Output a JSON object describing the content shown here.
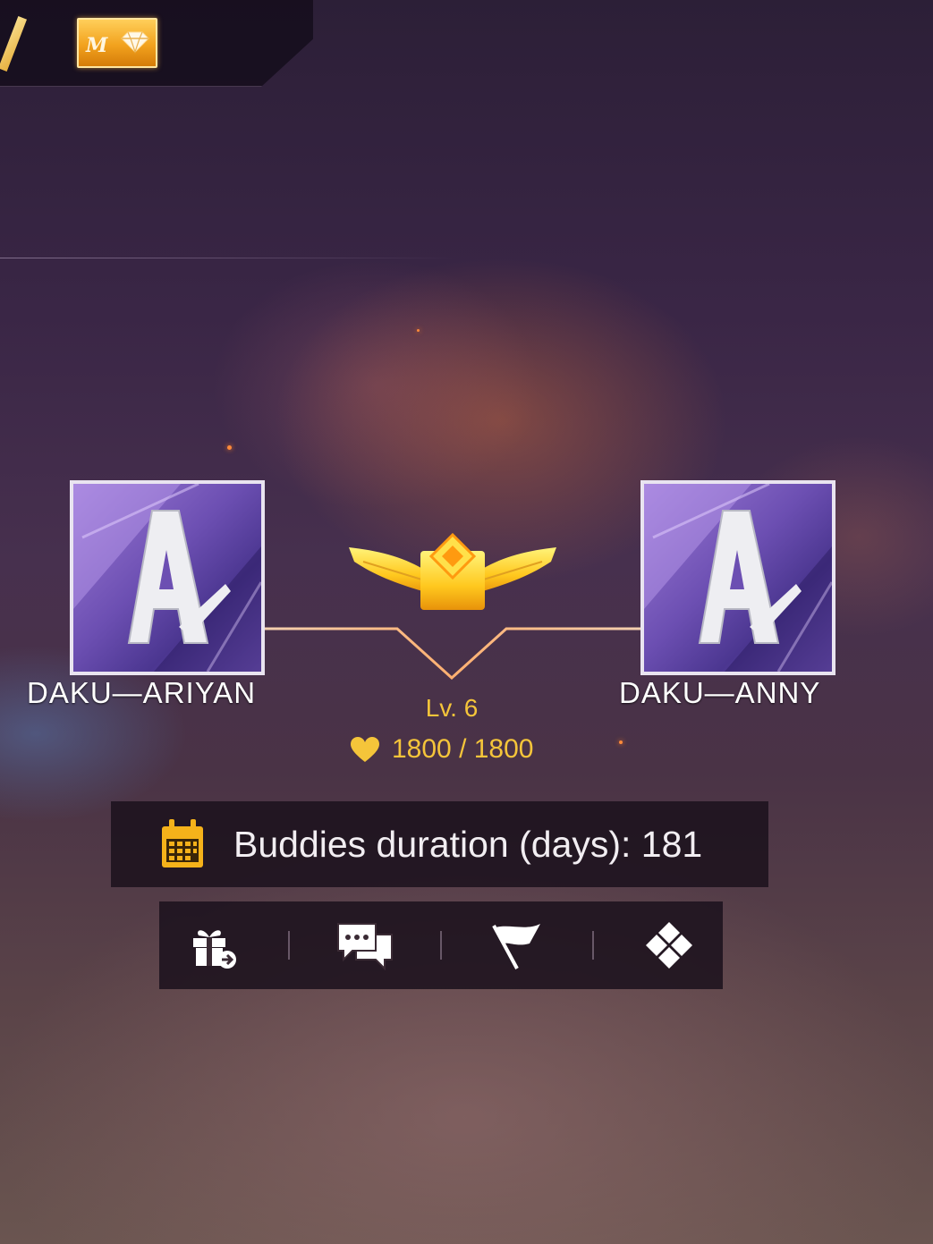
{
  "colors": {
    "accent_gold": "#f5c53a",
    "panel_bg": "#1c121e",
    "avatar_purple": "#6c4fb2"
  },
  "header": {
    "slash_icon": "gold-slash-icon",
    "badge": {
      "letter": "M",
      "icon": "diamond-icon"
    }
  },
  "buddies": {
    "left": {
      "name": "DAKU_ARIYAN",
      "avatar_letter": "A",
      "display": "DAKU—ARIYAN"
    },
    "right": {
      "name": "DAKU_ANNY",
      "avatar_letter": "A",
      "display": "DAKU—ANNY"
    },
    "emblem_icon": "winged-emblem-icon",
    "level": "Lv. 6",
    "intimacy": "1800 / 1800"
  },
  "duration": {
    "icon": "calendar-icon",
    "text": "Buddies duration (days): 181"
  },
  "actions": [
    {
      "icon": "gift-icon"
    },
    {
      "icon": "chat-icon"
    },
    {
      "icon": "flag-icon"
    },
    {
      "icon": "diamond-grid-icon"
    }
  ]
}
